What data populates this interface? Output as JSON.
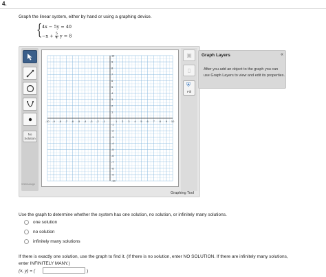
{
  "question": {
    "number": "4.",
    "prompt": "Graph the linear system, either by hand or using a graphing device.",
    "eq1": "4x  −   5y  =  40",
    "eq2_start": "−x  +",
    "eq2_num": "5",
    "eq2_den": "4",
    "eq2_end": "y  =  8"
  },
  "tool": {
    "tools": [
      "pointer-icon",
      "line-segment-icon",
      "circle-icon",
      "parabola-icon",
      "point-icon"
    ],
    "no_solution_label": "No Solution",
    "right_buttons": [
      "delete-icon",
      "trash-icon"
    ],
    "fill_label": "Fill",
    "caption": "Graphing Tool",
    "x_ticks": [
      "-10",
      "-9",
      "-8",
      "-7",
      "-6",
      "-5",
      "-4",
      "-3",
      "-2",
      "-1",
      "1",
      "2",
      "3",
      "4",
      "5",
      "6",
      "7",
      "8",
      "9",
      "10"
    ],
    "y_ticks": [
      "10",
      "9",
      "8",
      "7",
      "6",
      "5",
      "4",
      "3",
      "2",
      "1",
      "-1",
      "-2",
      "-3",
      "-4",
      "-5",
      "-6",
      "-7",
      "-8",
      "-9",
      "-10"
    ],
    "x_range": [
      -10,
      10
    ],
    "y_range": [
      -10,
      10
    ],
    "grid_color": "#7fb4dd",
    "logo_text": "WebAssign"
  },
  "layers": {
    "title": "Graph Layers",
    "collapse": "«",
    "body": "After you add an object to the graph you can use Graph Layers to view and edit its properties."
  },
  "part2": {
    "instruction": "Use the graph to determine whether the system has one solution, no solution, or infinitely many solutions.",
    "options": [
      "one solution",
      "no solution",
      "infinitely many solutions"
    ]
  },
  "part3": {
    "instruction_line1": "If there is exactly one solution, use the graph to find it. (If there is no solution, enter NO SOLUTION. If there are infinitely many solutions,",
    "instruction_line2": "enter INFINITELY MANY.)",
    "answer_label": "(x, y) = (",
    "answer_close": ")",
    "answer_value": ""
  }
}
